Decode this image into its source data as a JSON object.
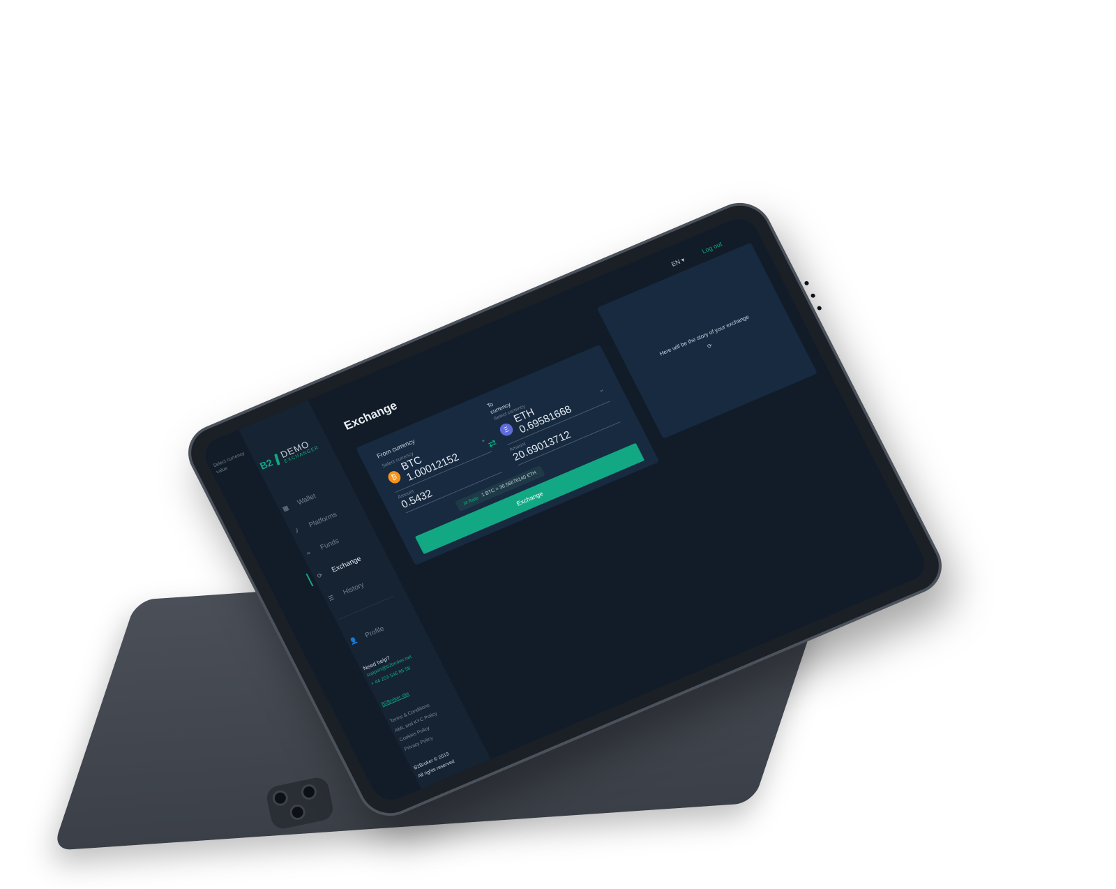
{
  "strip": {
    "text": "Select currency value"
  },
  "logo": {
    "b2": "B2",
    "demo": "DEMO",
    "exchanger": "EXCHANGER"
  },
  "nav": [
    {
      "label": "Wallet",
      "icon": "▦"
    },
    {
      "label": "Platforms",
      "icon": "⫽"
    },
    {
      "label": "Funds",
      "icon": "≈"
    },
    {
      "label": "Exchange",
      "icon": "⟳"
    },
    {
      "label": "History",
      "icon": "☰"
    }
  ],
  "profile": {
    "label": "Profile",
    "icon": "👤"
  },
  "help": {
    "title": "Need help?",
    "email": "support@b2broker.net",
    "phone": "+ 44 203 546 85 58"
  },
  "green_link": "B2Broker site",
  "footer_links": [
    "Terms & Conditions",
    "AML and KYC Policy",
    "Cookies Policy",
    "Privacy Policy"
  ],
  "copyright": {
    "line1": "B2Broker © 2019",
    "line2": "All rights reserved"
  },
  "topbar": {
    "lang": "EN ▾",
    "logout": "Log out"
  },
  "page": {
    "title": "Exchange"
  },
  "exchange": {
    "from_label": "From currency",
    "to_label_1": "To",
    "to_label_2": "currency",
    "from_select_label": "Select currency",
    "from_value": "BTC 1.00012152",
    "from_amount_label": "Amount",
    "from_amount": "0.5432",
    "to_select_label": "Select currency",
    "to_value": "ETH 0.69581668",
    "to_amount_label": "Amount",
    "to_amount": "20.69013712",
    "rate_label": "⇄ Rate",
    "rate_value": "1 BTC = 36.56676140 ETH",
    "button": "Exchange"
  },
  "story": {
    "text": "Here will be the story of your exchange",
    "icon": "⟳"
  }
}
